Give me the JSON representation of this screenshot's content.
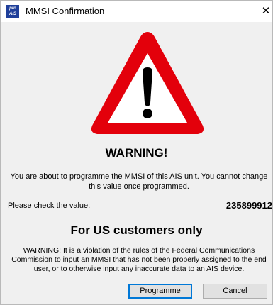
{
  "window": {
    "title": "MMSI Confirmation",
    "app_icon_text": "pro AIS",
    "close_glyph": "✕"
  },
  "icons": {
    "app": "app-logo-icon",
    "close": "close-icon",
    "warning": "warning-triangle-icon"
  },
  "colors": {
    "warning_red": "#e3000b",
    "warning_fill": "#ffffff",
    "primary_button_border": "#0078d7"
  },
  "content": {
    "heading": "WARNING!",
    "message": "You are about to programme the MMSI of this AIS unit. You cannot change this value once programmed.",
    "check_label": "Please check the value:",
    "mmsi_value": "235899912",
    "us_heading": "For US customers only",
    "fcc_notice": "WARNING: It is a violation of the rules of the Federal Communications Commission to input an MMSI that has not been properly assigned to the end user, or to otherwise input any inaccurate data to an AIS device."
  },
  "buttons": {
    "programme": "Programme",
    "cancel": "Cancel"
  }
}
